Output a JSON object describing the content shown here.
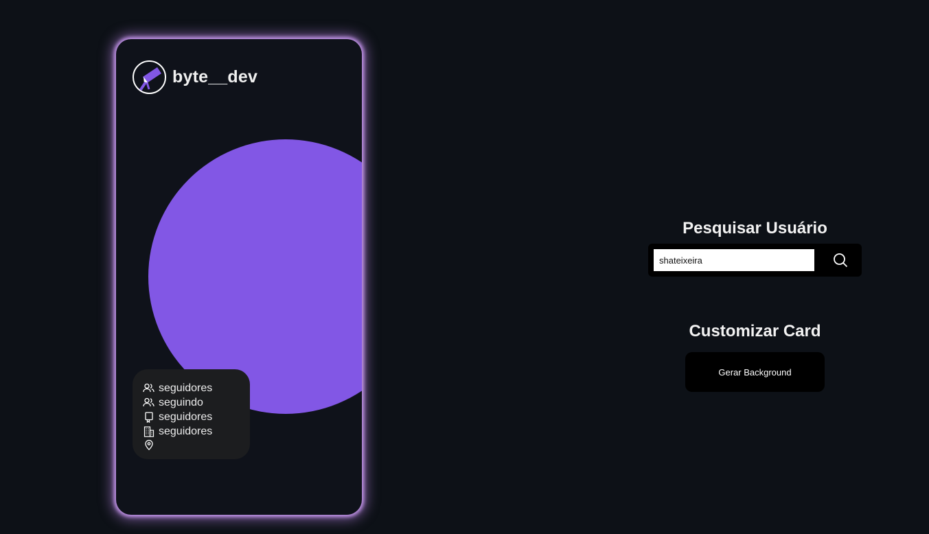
{
  "card": {
    "username": "byte__dev",
    "logo_icon": "telescope-logo-icon",
    "accent_color": "#8257e5",
    "glow_color": "#c596ec",
    "stats": [
      {
        "icon": "users-icon",
        "label": "seguidores"
      },
      {
        "icon": "users-icon",
        "label": "seguindo"
      },
      {
        "icon": "repo-icon",
        "label": "seguidores"
      },
      {
        "icon": "building-icon",
        "label": "seguidores"
      },
      {
        "icon": "location-pin-icon",
        "label": ""
      }
    ]
  },
  "search": {
    "title": "Pesquisar Usuário",
    "input_value": "shateixeira",
    "button_icon": "search-icon"
  },
  "customize": {
    "title": "Customizar Card",
    "button_label": "Gerar Background"
  }
}
